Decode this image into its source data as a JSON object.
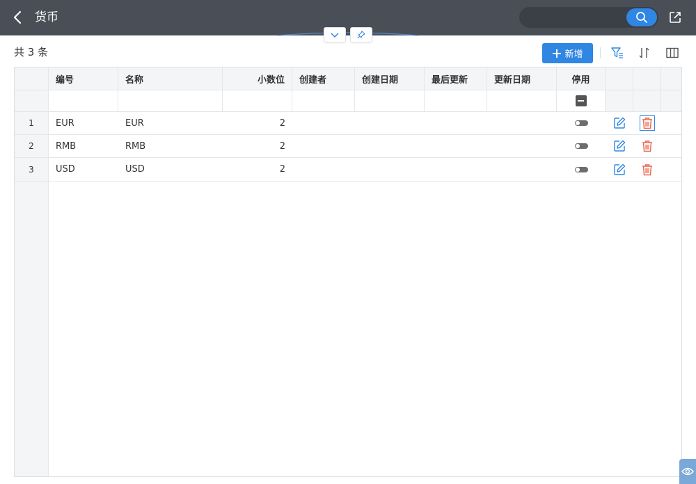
{
  "header": {
    "title": "货币",
    "search": {
      "value": "",
      "placeholder": ""
    }
  },
  "toolbar": {
    "total_label": "共 3 条",
    "add_label": "新增"
  },
  "table": {
    "columns": [
      "编号",
      "名称",
      "小数位",
      "创建者",
      "创建日期",
      "最后更新",
      "更新日期",
      "停用"
    ],
    "rows": [
      {
        "num": "1",
        "code": "EUR",
        "name": "EUR",
        "decimals": "2",
        "creator": "",
        "created": "",
        "last_updated": "",
        "updated": "",
        "disabled": false
      },
      {
        "num": "2",
        "code": "RMB",
        "name": "RMB",
        "decimals": "2",
        "creator": "",
        "created": "",
        "last_updated": "",
        "updated": "",
        "disabled": false
      },
      {
        "num": "3",
        "code": "USD",
        "name": "USD",
        "decimals": "2",
        "creator": "",
        "created": "",
        "last_updated": "",
        "updated": "",
        "disabled": false
      }
    ]
  },
  "icons": {
    "back": "back-icon",
    "search": "search-icon",
    "external": "external-link-icon",
    "collapse": "chevron-down-icon",
    "pin": "pin-icon",
    "add": "plus-icon",
    "filter": "filter-icon",
    "sort": "sort-icon",
    "columns": "columns-icon",
    "edit": "edit-icon",
    "delete": "trash-icon",
    "eye": "eye-icon"
  },
  "colors": {
    "topbar": "#4a4f57",
    "accent": "#2f86e3",
    "edit": "#2f86e3",
    "delete": "#e8664d",
    "header_bg": "#f4f5f7"
  }
}
